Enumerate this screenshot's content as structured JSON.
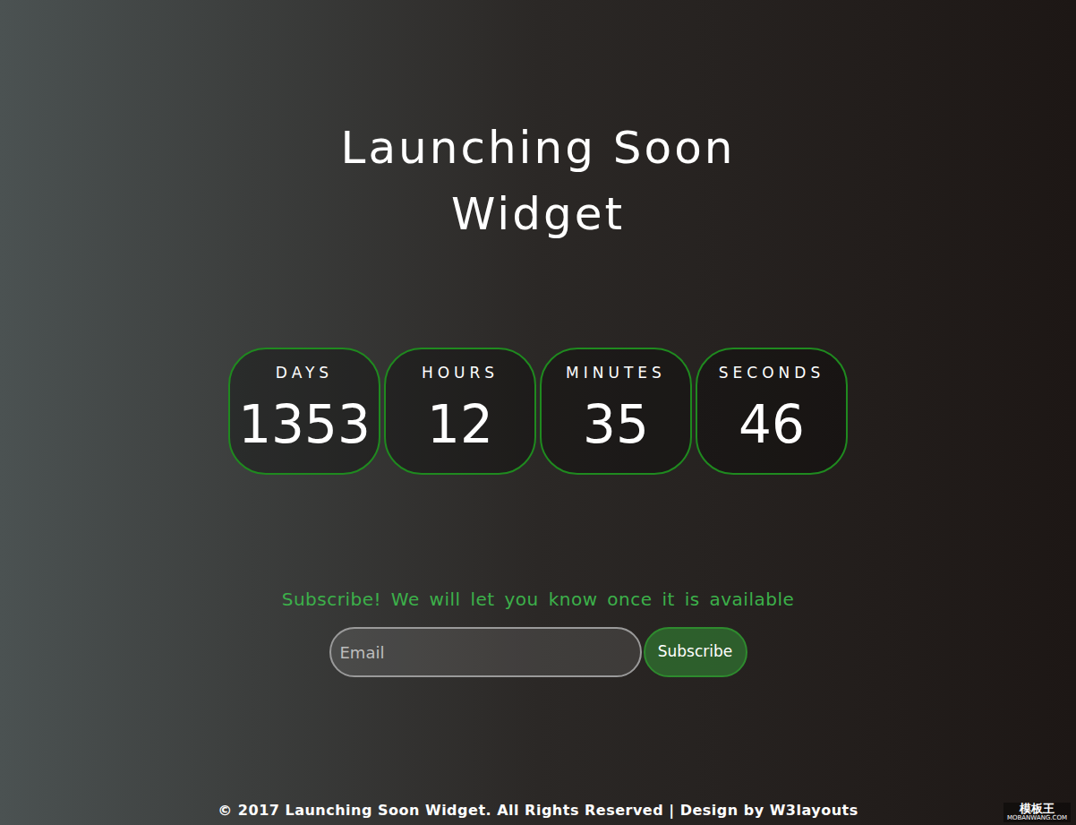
{
  "title": "Launching Soon Widget",
  "countdown": [
    {
      "label": "DAYS",
      "value": "1353"
    },
    {
      "label": "HOURS",
      "value": "12"
    },
    {
      "label": "MINUTES",
      "value": "35"
    },
    {
      "label": "SECONDS",
      "value": "46"
    }
  ],
  "subscribe": {
    "message": "Subscribe! We will let you know once it is available",
    "placeholder": "Email",
    "button": "Subscribe"
  },
  "footer": "© 2017 Launching Soon Widget. All Rights Reserved | Design by W3layouts",
  "watermark": {
    "brand": "模板王",
    "site": "MOBANWANG.COM"
  }
}
